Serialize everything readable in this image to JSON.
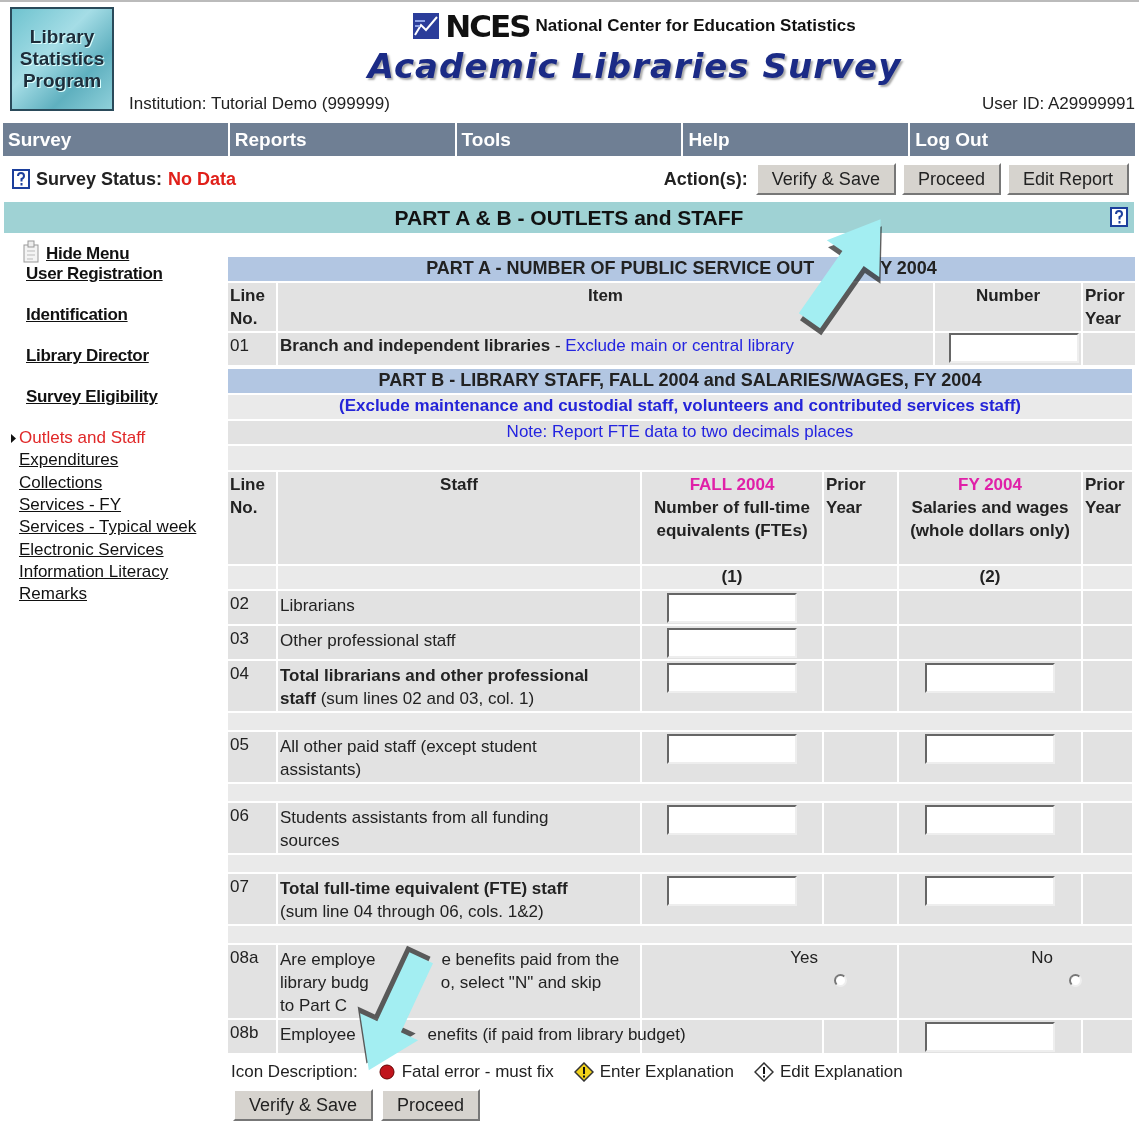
{
  "header": {
    "logo_lines": [
      "Library",
      "Statistics",
      "Program"
    ],
    "agency_short": "NCES",
    "agency_name": "National Center for Education Statistics",
    "title": "Academic Libraries Survey",
    "institution": "Institution: Tutorial Demo (999999)",
    "user_id": "User ID: A29999991"
  },
  "nav": [
    {
      "label": "Survey"
    },
    {
      "label": "Reports"
    },
    {
      "label": "Tools"
    },
    {
      "label": "Help"
    },
    {
      "label": "Log Out"
    }
  ],
  "status": {
    "label": "Survey Status:",
    "value": "No Data",
    "actions_label": "Action(s):",
    "actions": [
      "Verify & Save",
      "Proceed",
      "Edit Report"
    ]
  },
  "section_title": "PART A & B - OUTLETS and STAFF",
  "sidebar": {
    "hide_menu": "Hide Menu",
    "primary": [
      "User Registration",
      "Identification",
      "Library Director",
      "Survey Eligibility"
    ],
    "secondary": [
      {
        "label": "Outlets and Staff",
        "selected": true
      },
      {
        "label": "Expenditures",
        "selected": false
      },
      {
        "label": "Collections",
        "selected": false
      },
      {
        "label": "Services - FY",
        "selected": false
      },
      {
        "label": "Services - Typical week",
        "selected": false
      },
      {
        "label": "Electronic Services",
        "selected": false
      },
      {
        "label": "Information Literacy",
        "selected": false
      },
      {
        "label": "Remarks",
        "selected": false
      }
    ]
  },
  "part_a": {
    "title_parts": [
      "PART A - NUMBER OF PUBLIC SERVICE OUT",
      "Y 2004"
    ],
    "columns": [
      "Line No.",
      "Item",
      "Number",
      "Prior Year"
    ],
    "rows": [
      {
        "line": "01",
        "item": "**Branch and independent libraries** -",
        "note": "Exclude main or central library"
      }
    ]
  },
  "part_b": {
    "title": "PART B - LIBRARY STAFF, FALL 2004 and SALARIES/WAGES, FY 2004",
    "exclude_note": "(Exclude maintenance and custodial staff, volunteers and contributed services staff)",
    "note": "Note: Report FTE data to two decimals places",
    "columns": [
      {
        "kind": "line",
        "label": "Line No."
      },
      {
        "kind": "staff",
        "label": "Staff"
      },
      {
        "kind": "period",
        "period": "FALL 2004",
        "label": "Number of full-time equivalents (FTEs)",
        "number": "(1)"
      },
      {
        "kind": "prior",
        "label": "Prior Year"
      },
      {
        "kind": "period",
        "period": "FY 2004",
        "label": "Salaries and wages (whole dollars only)",
        "number": "(2)"
      },
      {
        "kind": "prior",
        "label": "Prior Year"
      }
    ],
    "rows": [
      {
        "kind": "entry",
        "line": "02",
        "text": "Librarians",
        "fte_field": true,
        "salary_field": false,
        "gap_before": false
      },
      {
        "kind": "entry",
        "line": "03",
        "text": "Other professional staff",
        "fte_field": true,
        "salary_field": false,
        "gap_before": false
      },
      {
        "kind": "entry",
        "line": "04",
        "text": "**Total librarians and other professional staff** (sum lines 02 and 03, col. 1)",
        "fte_field": true,
        "salary_field": true,
        "gap_before": false
      },
      {
        "kind": "entry",
        "line": "05",
        "text": "All other paid staff (except student assistants)",
        "fte_field": true,
        "salary_field": true,
        "gap_before": true
      },
      {
        "kind": "entry",
        "line": "06",
        "text": "Students assistants from all funding sources",
        "fte_field": true,
        "salary_field": true,
        "gap_before": true
      },
      {
        "kind": "entry",
        "line": "07",
        "text": "**Total full-time equivalent (FTE) staff** (sum line 04 through 06, cols. 1&2)",
        "fte_field": true,
        "salary_field": true,
        "gap_before": true
      },
      {
        "kind": "question",
        "line": "08a",
        "lines": [
          [
            "Are employe",
            "e benefits paid from the"
          ],
          [
            "library budg",
            "o, select \"N\" and skip"
          ],
          [
            "to Part C"
          ]
        ],
        "options": [
          {
            "label": "Yes",
            "selected": false
          },
          {
            "label": "No",
            "selected": false
          }
        ],
        "gap_before": true
      },
      {
        "kind": "split",
        "line": "08b",
        "parts": [
          "Employee",
          "enefits (if paid from library budget)"
        ],
        "fte_field": false,
        "salary_field": true,
        "gap_before": false
      }
    ]
  },
  "legend": {
    "label": "Icon Description:",
    "items": [
      {
        "kind": "fatal",
        "label": "Fatal error - must fix"
      },
      {
        "kind": "enter",
        "label": "Enter Explanation"
      },
      {
        "kind": "edit",
        "label": "Edit Explanation"
      }
    ]
  },
  "bottom_buttons": [
    "Verify & Save",
    "Proceed"
  ]
}
